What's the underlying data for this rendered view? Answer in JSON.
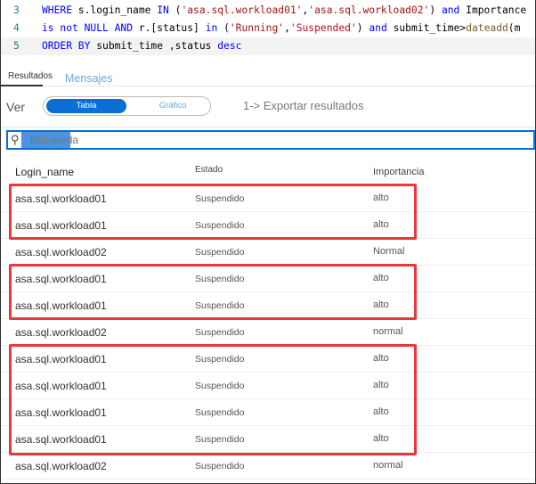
{
  "code": [
    {
      "num": "3",
      "tokens": [
        [
          "kw",
          "WHERE "
        ],
        [
          "tx",
          "s.login_name "
        ],
        [
          "kw",
          "IN "
        ],
        [
          "tx",
          "("
        ],
        [
          "st",
          "'asa.sql.workload01'"
        ],
        [
          "tx",
          ","
        ],
        [
          "st",
          "'asa.sql.workload02'"
        ],
        [
          "tx",
          ") "
        ],
        [
          "kw",
          "and "
        ],
        [
          "tx",
          "Importance"
        ]
      ]
    },
    {
      "num": "4",
      "tokens": [
        [
          "kw",
          "is not NULL AND "
        ],
        [
          "tx",
          "r.[status] "
        ],
        [
          "kw",
          "in "
        ],
        [
          "tx",
          "("
        ],
        [
          "st",
          "'Running'"
        ],
        [
          "tx",
          ","
        ],
        [
          "st",
          "'Suspended'"
        ],
        [
          "tx",
          ") "
        ],
        [
          "kw",
          "and "
        ],
        [
          "tx",
          "submit_time>"
        ],
        [
          "fn",
          "dateadd"
        ],
        [
          "tx",
          "(m"
        ]
      ]
    },
    {
      "num": "5",
      "tokens": [
        [
          "kw",
          "ORDER BY "
        ],
        [
          "tx",
          "submit_time ,status "
        ],
        [
          "kw",
          "desc"
        ]
      ]
    }
  ],
  "tabs": {
    "results": "Resultados",
    "messages": "Mensajes"
  },
  "view": {
    "label": "Ver",
    "table": "Tabla",
    "chart": "Gráfico",
    "export": "1-> Exportar resultados"
  },
  "search": {
    "placeholder": "Búsqueda"
  },
  "columns": [
    "Login_name",
    "Estado",
    "Importancia"
  ],
  "rows": [
    [
      "asa.sql.workload01",
      "Suspendido",
      "alto"
    ],
    [
      "asa.sql.workload01",
      "Suspendido",
      "alto"
    ],
    [
      "asa.sql.workload02",
      "Suspendido",
      "Normal"
    ],
    [
      "asa.sql.workload01",
      "Suspendido",
      "alto"
    ],
    [
      "asa.sql.workload01",
      "Suspendido",
      "alto"
    ],
    [
      "asa.sql.workload02",
      "Suspendido",
      "normal"
    ],
    [
      "asa.sql.workload01",
      "Suspendido",
      "alto"
    ],
    [
      "asa.sql.workload01",
      "Suspendido",
      "alto"
    ],
    [
      "asa.sql.workload01",
      "Suspendido",
      "alto"
    ],
    [
      "asa.sql.workload01",
      "Suspendido",
      "alto"
    ],
    [
      "asa.sql.workload02",
      "Suspendido",
      "normal"
    ]
  ],
  "highlight_color": "#e8383d"
}
